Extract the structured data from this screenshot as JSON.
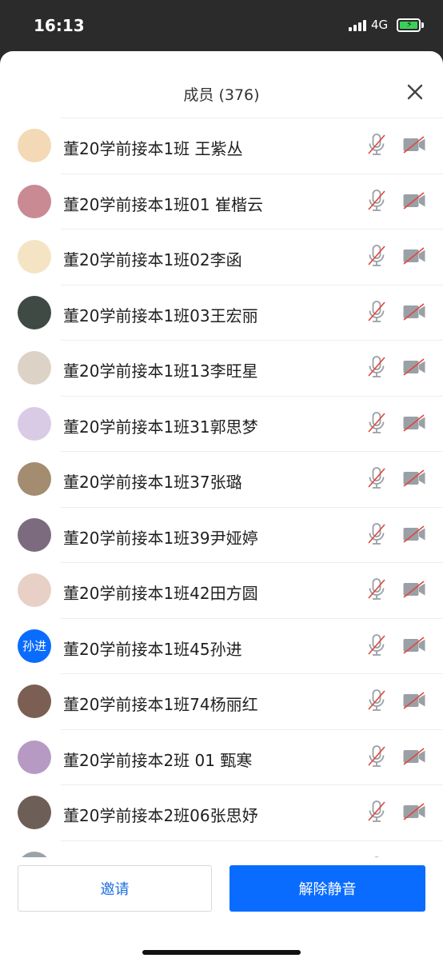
{
  "status": {
    "time": "16:13",
    "network": "4G"
  },
  "header": {
    "title": "成员 (376)"
  },
  "members": [
    {
      "name": "董20学前接本1班 王紫丛",
      "avatar": {
        "type": "image",
        "color": "#f3d9b5"
      }
    },
    {
      "name": "董20学前接本1班01 崔楷云",
      "avatar": {
        "type": "image",
        "color": "#c98a94"
      }
    },
    {
      "name": "董20学前接本1班02李函",
      "avatar": {
        "type": "image",
        "color": "#f4e4c4"
      }
    },
    {
      "name": "董20学前接本1班03王宏丽",
      "avatar": {
        "type": "image",
        "color": "#3f4a45"
      }
    },
    {
      "name": "董20学前接本1班13李旺星",
      "avatar": {
        "type": "image",
        "color": "#ddd2c6"
      }
    },
    {
      "name": "董20学前接本1班31郭思梦",
      "avatar": {
        "type": "image",
        "color": "#d9cbe6"
      }
    },
    {
      "name": "董20学前接本1班37张璐",
      "avatar": {
        "type": "image",
        "color": "#a38c70"
      }
    },
    {
      "name": "董20学前接本1班39尹娅婷",
      "avatar": {
        "type": "image",
        "color": "#7c6a7e"
      }
    },
    {
      "name": "董20学前接本1班42田方圆",
      "avatar": {
        "type": "image",
        "color": "#e8d0c6"
      }
    },
    {
      "name": "董20学前接本1班45孙进",
      "avatar": {
        "type": "text",
        "text": "孙进",
        "color": "#0a6cff"
      }
    },
    {
      "name": "董20学前接本1班74杨丽红",
      "avatar": {
        "type": "image",
        "color": "#7a5f52"
      }
    },
    {
      "name": "董20学前接本2班 01 甄寒",
      "avatar": {
        "type": "image",
        "color": "#b79ac4"
      }
    },
    {
      "name": "董20学前接本2班06张思妤",
      "avatar": {
        "type": "image",
        "color": "#6d5f57"
      }
    },
    {
      "name": "",
      "avatar": {
        "type": "image",
        "color": "#9aa2a8"
      }
    }
  ],
  "icons": {
    "mic": "mic-muted-icon",
    "camera": "camera-off-icon",
    "close": "close-icon"
  },
  "colors": {
    "accent": "#0a6cff",
    "muted_red": "#e0463b",
    "icon_gray": "#9aa0a6"
  },
  "footer": {
    "invite_label": "邀请",
    "unmute_label": "解除静音"
  }
}
